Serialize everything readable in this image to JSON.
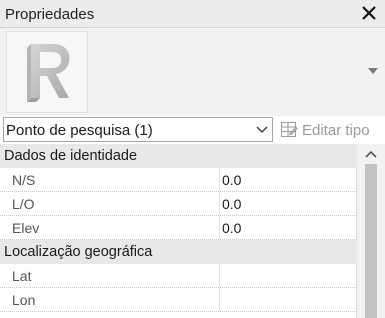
{
  "panel": {
    "title": "Propriedades"
  },
  "type_selector": {
    "selected": "Ponto de pesquisa (1)",
    "edit_type_label": "Editar tipo"
  },
  "groups": [
    {
      "label": "Dados de identidade",
      "rows": [
        {
          "name": "N/S",
          "value": "0.0"
        },
        {
          "name": "L/O",
          "value": "0.0"
        },
        {
          "name": "Elev",
          "value": "0.0"
        }
      ]
    },
    {
      "label": "Localização geográfica",
      "rows": [
        {
          "name": "Lat",
          "value": ""
        },
        {
          "name": "Lon",
          "value": ""
        }
      ]
    }
  ],
  "icons": {
    "close": "close-icon",
    "revit_logo": "revit-logo-icon",
    "dropdown": "chevron-down-icon",
    "edit_type": "edit-type-icon",
    "scroll_up": "scroll-up-icon"
  },
  "colors": {
    "titlebar_bg": "#ececec",
    "group_header_bg": "#e8e8e8",
    "disabled_text": "#9a9a9a"
  }
}
